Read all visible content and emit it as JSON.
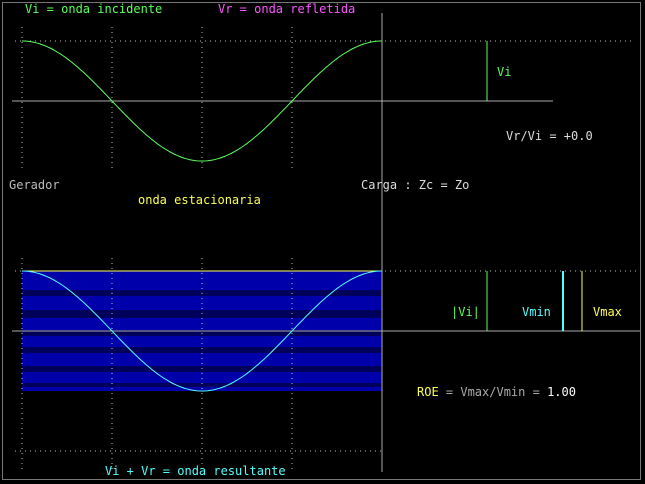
{
  "legend": {
    "incident": "Vi = onda incidente",
    "reflected": "Vr = onda refletida"
  },
  "labels": {
    "vi": "Vi",
    "ratio_label": "Vr/Vi = ",
    "ratio_value": "+0.0",
    "generator": "Gerador",
    "load": "Carga : Zc = Zo",
    "standing_title": "onda estacionaria",
    "abs_vi": "|Vi|",
    "vmin": "Vmin",
    "vmax": "Vmax",
    "roe_label": "ROE",
    "roe_formula": " = Vmax/Vmin = ",
    "roe_value": "1.00",
    "resultant": "Vi + Vr = onda resultante"
  },
  "values": {
    "reflection_coefficient": 0.0,
    "roe": 1.0
  },
  "colors": {
    "incident": "#5cff5c",
    "reflected": "#ff55ff",
    "resultant": "#55ffff",
    "yellow": "#ffff55",
    "band": "#0000aa",
    "axis": "#aaaaaa"
  }
}
